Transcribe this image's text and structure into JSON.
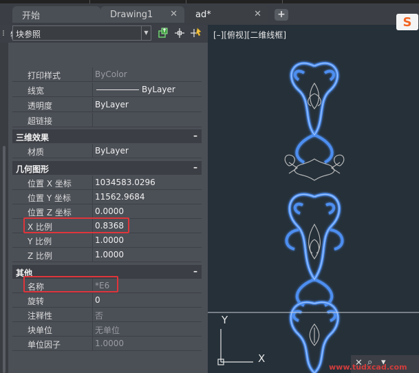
{
  "tabs": [
    {
      "label": "开始",
      "active": false
    },
    {
      "label": "Drawing1",
      "active": false
    },
    {
      "label": "ad*",
      "active": true
    }
  ],
  "tab_close_glyph": "✕",
  "new_tab_glyph": "+",
  "panel": {
    "title": "特性",
    "selector_value": "块参照",
    "toolbar_icons": [
      "quick-select-icon",
      "select-objects-icon",
      "toggle-pickadd-icon"
    ]
  },
  "general_rows": [
    {
      "label": "打印样式",
      "value": "ByColor",
      "dim": true
    },
    {
      "label": "线宽",
      "value": "ByLayer",
      "line": true
    },
    {
      "label": "透明度",
      "value": "ByLayer"
    },
    {
      "label": "超链接",
      "value": ""
    }
  ],
  "sections": {
    "effects": "三维效果",
    "geometry": "几何图形",
    "misc": "其他",
    "collapse_glyph": "–"
  },
  "effects_rows": [
    {
      "label": "材质",
      "value": "ByLayer"
    }
  ],
  "geometry_rows": [
    {
      "label": "位置 X 坐标",
      "value": "1034583.0296"
    },
    {
      "label": "位置 Y 坐标",
      "value": "11562.9684"
    },
    {
      "label": "位置 Z 坐标",
      "value": "0.0000"
    },
    {
      "label": "X 比例",
      "value": "0.8368",
      "highlight": true
    },
    {
      "label": "Y 比例",
      "value": "1.0000"
    },
    {
      "label": "Z 比例",
      "value": "1.0000"
    }
  ],
  "misc_rows": [
    {
      "label": "名称",
      "value": "*E6",
      "dim": true,
      "highlight": true
    },
    {
      "label": "旋转",
      "value": "0"
    },
    {
      "label": "注释性",
      "value": "否",
      "dim": true
    },
    {
      "label": "块单位",
      "value": "无单位",
      "dim": true
    },
    {
      "label": "单位因子",
      "value": "1.0000",
      "dim": true
    }
  ],
  "viewport": {
    "label": "[–][俯视][二维线框]",
    "ucs_y": "Y",
    "ucs_x": "X"
  },
  "logo_text": "S",
  "watermark": "www.tudxcad.com",
  "colors": {
    "highlight": "#e0353b",
    "ornament_blue": "#3f7be0",
    "ornament_glow": "#7fb4ff",
    "ornament_gray": "#b8b8b8"
  }
}
